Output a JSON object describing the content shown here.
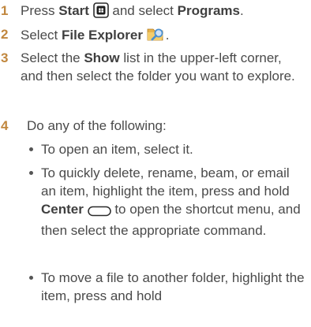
{
  "colors": {
    "step_number": "#c1873e",
    "body_text": "#4a4a4a",
    "start_icon_fill": "#1f1f1f",
    "folder_icon": "#e8b34a",
    "magnifier_icon": "#4a8fd0"
  },
  "icons": {
    "start": "windows-start-icon",
    "file_explorer": "folder-magnifier-icon",
    "center": "center-button-icon"
  },
  "steps": [
    {
      "number": "1",
      "t1": "Press ",
      "b1": "Start",
      "t2": " and select ",
      "b2": "Programs",
      "t3": "."
    },
    {
      "number": "2",
      "t1": "Select ",
      "b1": "File Explorer",
      "t2": "."
    },
    {
      "number": "3",
      "t1": "Select the ",
      "b1": "Show",
      "t2": " list in the upper-left corner, and then select the folder you want to explore."
    },
    {
      "number": "4",
      "t1": "Do any of the following:",
      "bullets": [
        {
          "text": "To open an item, select it."
        },
        {
          "t1": "To quickly delete, rename, beam, or email an item, highlight the item, press and hold ",
          "b1": "Center",
          "t2": " to open the shortcut menu, and then select the appropriate command."
        },
        {
          "text": "To move a file to another folder, highlight the item, press and hold"
        }
      ]
    }
  ]
}
